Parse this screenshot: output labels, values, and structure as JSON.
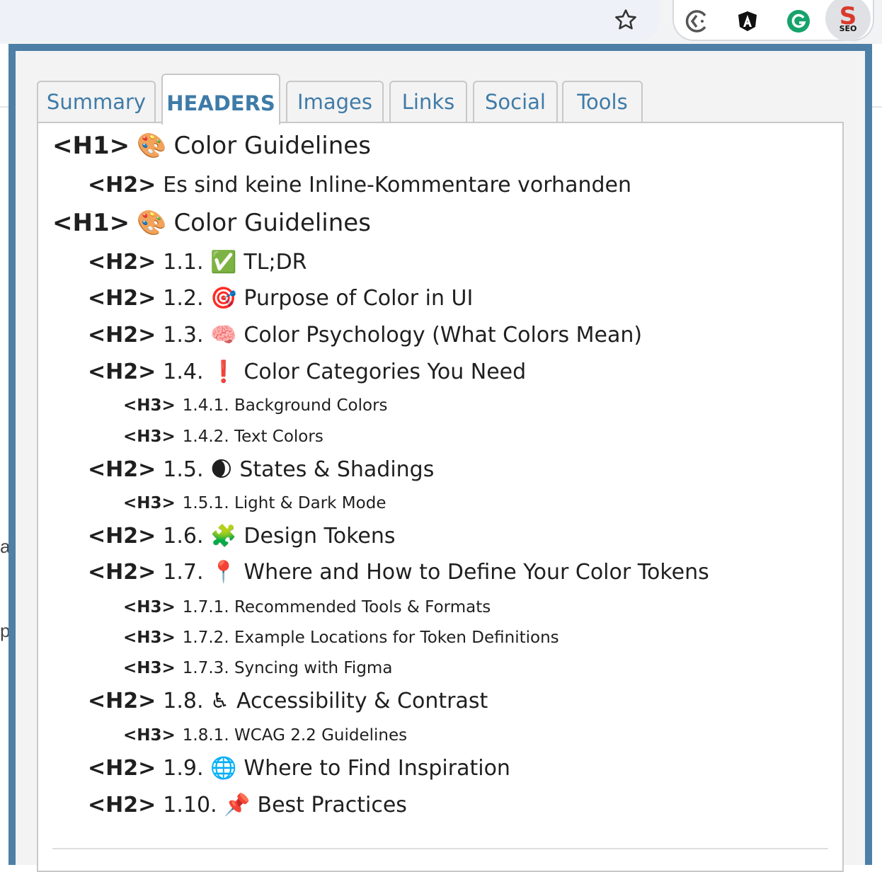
{
  "popup": {
    "tabs": [
      {
        "label": "Summary",
        "active": false
      },
      {
        "label": "HEADERS",
        "active": true
      },
      {
        "label": "Images",
        "active": false
      },
      {
        "label": "Links",
        "active": false
      },
      {
        "label": "Social",
        "active": false
      },
      {
        "label": "Tools",
        "active": false
      }
    ],
    "headers": [
      {
        "level": "<H1>",
        "icon": "🎨",
        "text": "Color Guidelines"
      },
      {
        "level": "<H2>",
        "icon": "",
        "text": "Es sind keine Inline-Kommentare vorhanden"
      },
      {
        "level": "<H1>",
        "icon": "🎨",
        "text": "Color Guidelines"
      },
      {
        "level": "<H2>",
        "prefix": "1.1.",
        "icon": "✅",
        "text": "TL;DR"
      },
      {
        "level": "<H2>",
        "prefix": "1.2.",
        "icon": "🎯",
        "text": "Purpose of Color in UI"
      },
      {
        "level": "<H2>",
        "prefix": "1.3.",
        "icon": "🧠",
        "text": "Color Psychology (What Colors Mean)"
      },
      {
        "level": "<H2>",
        "prefix": "1.4.",
        "icon": "❗",
        "text": "Color Categories You Need"
      },
      {
        "level": "<H3>",
        "prefix": "1.4.1.",
        "icon": "",
        "text": "Background Colors"
      },
      {
        "level": "<H3>",
        "prefix": "1.4.2.",
        "icon": "",
        "text": "Text Colors"
      },
      {
        "level": "<H2>",
        "prefix": "1.5.",
        "icon": "🌒",
        "text": "States & Shadings"
      },
      {
        "level": "<H3>",
        "prefix": "1.5.1.",
        "icon": "",
        "text": "Light & Dark Mode"
      },
      {
        "level": "<H2>",
        "prefix": "1.6.",
        "icon": "🧩",
        "text": "Design Tokens"
      },
      {
        "level": "<H2>",
        "prefix": "1.7.",
        "icon": "📍",
        "text": "Where and How to Define Your Color Tokens"
      },
      {
        "level": "<H3>",
        "prefix": "1.7.1.",
        "icon": "",
        "text": "Recommended Tools & Formats"
      },
      {
        "level": "<H3>",
        "prefix": "1.7.2.",
        "icon": "",
        "text": "Example Locations for Token Definitions"
      },
      {
        "level": "<H3>",
        "prefix": "1.7.3.",
        "icon": "",
        "text": "Syncing with Figma"
      },
      {
        "level": "<H2>",
        "prefix": "1.8.",
        "icon": "♿",
        "text": "Accessibility & Contrast"
      },
      {
        "level": "<H3>",
        "prefix": "1.8.1.",
        "icon": "",
        "text": "WCAG 2.2 Guidelines"
      },
      {
        "level": "<H2>",
        "prefix": "1.9.",
        "icon": "🌐",
        "text": "Where to Find Inspiration"
      },
      {
        "level": "<H2>",
        "prefix": "1.10.",
        "icon": "📌",
        "text": "Best Practices"
      }
    ]
  },
  "toolbar": {
    "bookmark_icon": "star-icon",
    "extensions": [
      {
        "name": "reload-circle-icon"
      },
      {
        "name": "angular-icon"
      },
      {
        "name": "grammarly-icon"
      },
      {
        "name": "seo-extension-icon",
        "label": "SEO"
      }
    ]
  },
  "page_fragments": [
    "a",
    "pe"
  ],
  "colors": {
    "popup_border": "#4e7fa6",
    "tab_text": "#3f7ba8",
    "seo_red": "#d93a2b"
  }
}
